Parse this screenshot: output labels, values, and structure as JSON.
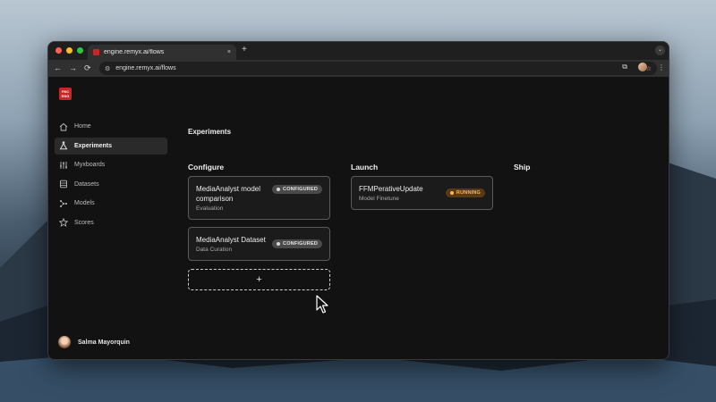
{
  "browser": {
    "tab_title": "engine.remyx.ai/flows",
    "tab_close": "×",
    "new_tab": "+",
    "tab_menu": "⌄",
    "url": "engine.remyx.ai/flows",
    "back": "←",
    "forward": "→",
    "reload": "⟳",
    "bookmark": "☆",
    "extensions": "⧉",
    "menu": "⋮"
  },
  "app": {
    "logo_text": "FNC ENG",
    "sidebar": {
      "items": [
        {
          "label": "Home",
          "icon": "home-icon"
        },
        {
          "label": "Experiments",
          "icon": "flask-icon",
          "active": true
        },
        {
          "label": "Myxboards",
          "icon": "sliders-icon"
        },
        {
          "label": "Datasets",
          "icon": "database-icon"
        },
        {
          "label": "Models",
          "icon": "network-icon"
        },
        {
          "label": "Scores",
          "icon": "star-icon"
        }
      ]
    },
    "user": {
      "name": "Salma Mayorquin"
    },
    "page_title": "Experiments",
    "columns": [
      {
        "title": "Configure"
      },
      {
        "title": "Launch"
      },
      {
        "title": "Ship"
      }
    ],
    "cards": {
      "configure": [
        {
          "title": "MediaAnalyst model comparison",
          "subtitle": "Evaluation",
          "status": "CONFIGURED"
        },
        {
          "title": "MediaAnalyst Dataset",
          "subtitle": "Data Curation",
          "status": "CONFIGURED"
        }
      ],
      "launch": [
        {
          "title": "FFMPerativeUpdate",
          "subtitle": "Model Finetune",
          "status": "RUNNING"
        }
      ]
    },
    "add_label": "+"
  },
  "colors": {
    "accent_red": "#c62828",
    "running": "#ffb74d",
    "configured": "#4a4a4a"
  }
}
